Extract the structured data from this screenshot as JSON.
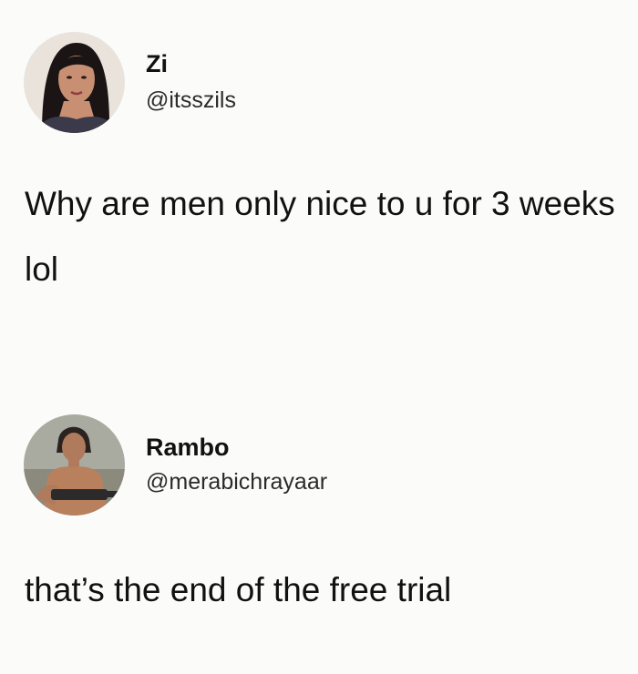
{
  "tweets": [
    {
      "display_name": "Zi",
      "handle": "@itsszils",
      "text": "Why are men only nice to u for 3 weeks lol"
    },
    {
      "display_name": "Rambo",
      "handle": "@merabichrayaar",
      "text": "that’s the end of the free trial"
    }
  ]
}
